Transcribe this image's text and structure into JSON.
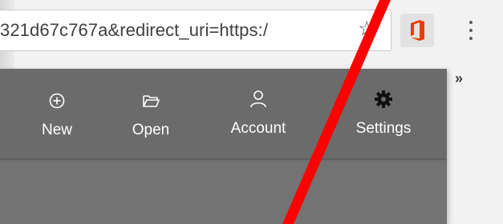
{
  "browser": {
    "url": "321d67c767a&redirect_uri=https:/",
    "overflow_chevron": "»"
  },
  "popup": {
    "actions": [
      {
        "label": "New",
        "icon": "plus-circle-icon"
      },
      {
        "label": "Open",
        "icon": "folder-open-icon"
      },
      {
        "label": "Account",
        "icon": "person-icon"
      },
      {
        "label": "Settings",
        "icon": "gear-icon"
      }
    ]
  },
  "colors": {
    "popup_bg": "#707070",
    "office_orange": "#eb3c00",
    "annotation_red": "#ff0000"
  }
}
